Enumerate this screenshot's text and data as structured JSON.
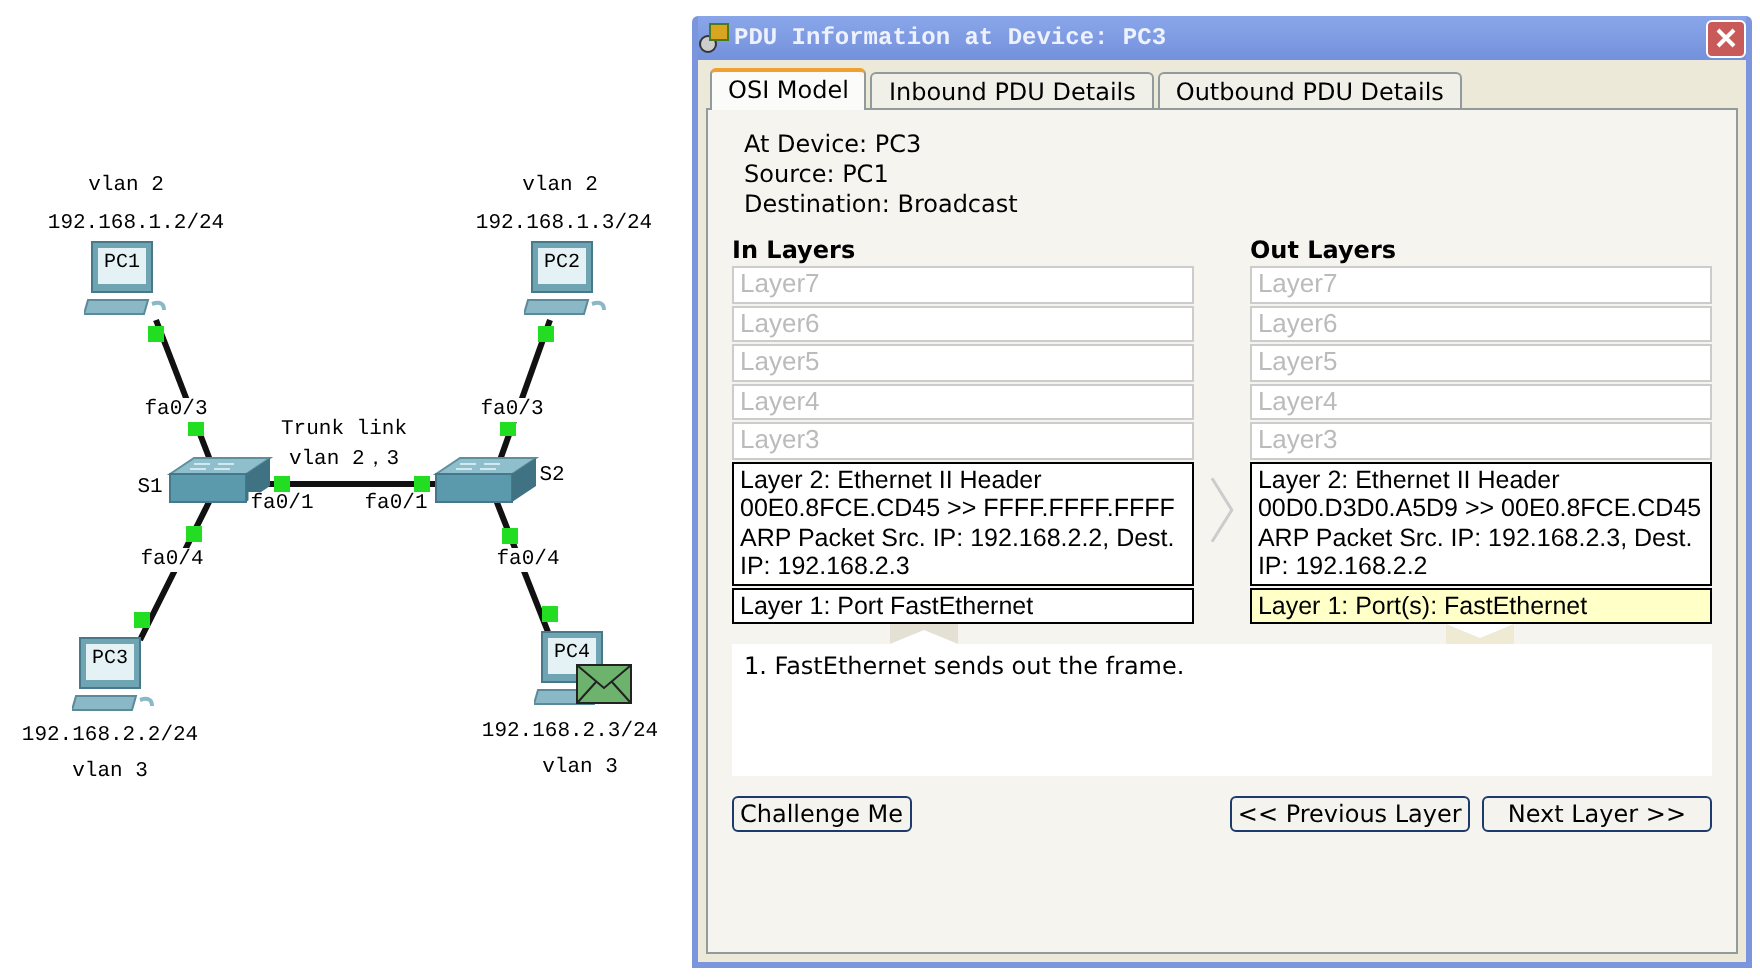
{
  "diagram": {
    "pcs": [
      {
        "name": "PC1",
        "vlan": "vlan 2",
        "ip": "192.168.1.2/24",
        "has_pdu": false
      },
      {
        "name": "PC2",
        "vlan": "vlan 2",
        "ip": "192.168.1.3/24",
        "has_pdu": false
      },
      {
        "name": "PC3",
        "vlan": "vlan 3",
        "ip": "192.168.2.2/24",
        "has_pdu": false
      },
      {
        "name": "PC4",
        "vlan": "vlan 3",
        "ip": "192.168.2.3/24",
        "has_pdu": true
      }
    ],
    "switches": [
      {
        "name": "S1"
      },
      {
        "name": "S2"
      }
    ],
    "ports": [
      "fa0/3",
      "fa0/3",
      "fa0/1",
      "fa0/1",
      "fa0/4",
      "fa0/4"
    ],
    "trunk_label": [
      "Trunk link",
      "vlan 2，3"
    ]
  },
  "dialog": {
    "title": "PDU Information at Device: PC3",
    "tabs": [
      {
        "label": "OSI Model",
        "selected": true
      },
      {
        "label": "Inbound PDU Details",
        "selected": false
      },
      {
        "label": "Outbound PDU Details",
        "selected": false
      }
    ],
    "info": [
      "At Device: PC3",
      "Source: PC1",
      "Destination: Broadcast"
    ],
    "in_layers": {
      "heading": "In Layers",
      "layers": [
        {
          "text": "Layer7",
          "active": false,
          "selected": false
        },
        {
          "text": "Layer6",
          "active": false,
          "selected": false
        },
        {
          "text": "Layer5",
          "active": false,
          "selected": false
        },
        {
          "text": "Layer4",
          "active": false,
          "selected": false
        },
        {
          "text": "Layer3",
          "active": false,
          "selected": false
        },
        {
          "text": "Layer 2: Ethernet II Header 00E0.8FCE.CD45 >> FFFF.FFFF.FFFF ARP Packet Src. IP: 192.168.2.2, Dest. IP: 192.168.2.3",
          "active": true,
          "selected": false
        },
        {
          "text": "Layer 1: Port FastEthernet",
          "active": true,
          "selected": false
        }
      ]
    },
    "out_layers": {
      "heading": "Out Layers",
      "layers": [
        {
          "text": "Layer7",
          "active": false,
          "selected": false
        },
        {
          "text": "Layer6",
          "active": false,
          "selected": false
        },
        {
          "text": "Layer5",
          "active": false,
          "selected": false
        },
        {
          "text": "Layer4",
          "active": false,
          "selected": false
        },
        {
          "text": "Layer3",
          "active": false,
          "selected": false
        },
        {
          "text": "Layer 2: Ethernet II Header 00D0.D3D0.A5D9 >> 00E0.8FCE.CD45 ARP Packet Src. IP: 192.168.2.3, Dest. IP: 192.168.2.2",
          "active": true,
          "selected": false
        },
        {
          "text": "Layer 1: Port(s): FastEthernet",
          "active": true,
          "selected": true
        }
      ]
    },
    "description": "1. FastEthernet sends out the frame.",
    "buttons": {
      "left": [
        "Challenge Me"
      ],
      "right": [
        "<< Previous Layer",
        "Next Layer >>"
      ]
    }
  }
}
